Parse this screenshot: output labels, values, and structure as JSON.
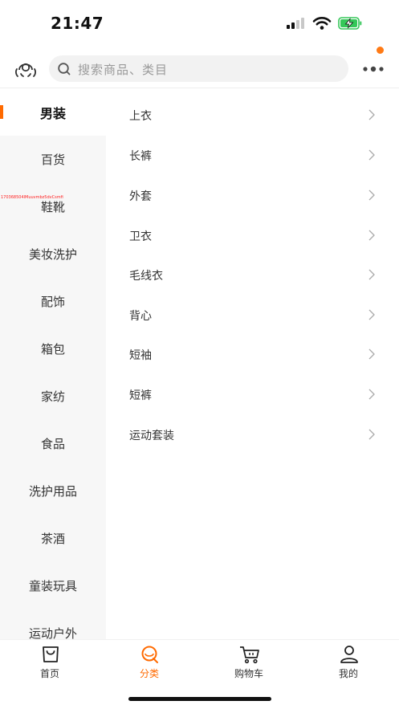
{
  "status_bar": {
    "time": "21:47"
  },
  "header": {
    "search_placeholder": "搜索商品、类目"
  },
  "sidebar": {
    "items": [
      {
        "label": "男装",
        "active": true
      },
      {
        "label": "百货"
      },
      {
        "label": "鞋靴"
      },
      {
        "label": "美妆洗护"
      },
      {
        "label": "配饰"
      },
      {
        "label": "箱包"
      },
      {
        "label": "家纺"
      },
      {
        "label": "食品"
      },
      {
        "label": "洗护用品"
      },
      {
        "label": "茶酒"
      },
      {
        "label": "童装玩具"
      },
      {
        "label": "运动户外"
      }
    ],
    "debug_text": "170368504lMuuvmbz5dvCsmfi"
  },
  "subcategories": [
    {
      "label": "上衣"
    },
    {
      "label": "长裤"
    },
    {
      "label": "外套"
    },
    {
      "label": "卫衣"
    },
    {
      "label": "毛线衣"
    },
    {
      "label": "背心"
    },
    {
      "label": "短袖"
    },
    {
      "label": "短裤"
    },
    {
      "label": "运动套装"
    }
  ],
  "tabbar": {
    "tabs": [
      {
        "label": "首页",
        "icon": "shopping-bag-icon"
      },
      {
        "label": "分类",
        "icon": "category-search-icon",
        "active": true
      },
      {
        "label": "购物车",
        "icon": "cart-icon"
      },
      {
        "label": "我的",
        "icon": "user-icon"
      }
    ]
  },
  "colors": {
    "accent": "#ff6a00",
    "badge": "#ff7a15",
    "battery": "#35c759"
  }
}
